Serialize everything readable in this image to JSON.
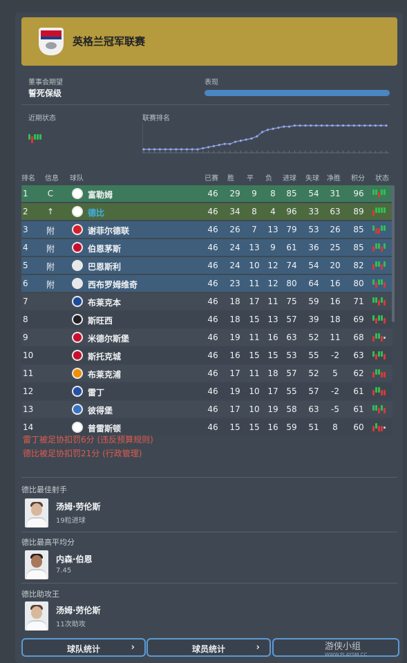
{
  "header": {
    "title": "英格兰冠军联赛",
    "logo_icon": "efl-logo-icon"
  },
  "board": {
    "label": "董事会期望",
    "value": "誓死保级"
  },
  "performance": {
    "label": "表现",
    "fraction": 1.0,
    "color": "#4a86c2"
  },
  "recent_form": {
    "label": "近期状态"
  },
  "league_position": {
    "label": "联赛排名"
  },
  "table": {
    "headers": [
      "排名",
      "信息",
      "球队",
      "已赛",
      "胜",
      "平",
      "负",
      "进球",
      "失球",
      "净胜",
      "积分",
      "状态"
    ],
    "rows": [
      {
        "pos": "1",
        "info": "C",
        "team": "富勒姆",
        "p": "46",
        "w": "29",
        "d": "9",
        "l": "8",
        "gf": "85",
        "ga": "54",
        "gd": "31",
        "pts": "96",
        "badge": "fulham-badge-icon"
      },
      {
        "pos": "2",
        "info": "↑",
        "team": "德比",
        "p": "46",
        "w": "34",
        "d": "8",
        "l": "4",
        "gf": "96",
        "ga": "33",
        "gd": "63",
        "pts": "89",
        "badge": "derby-badge-icon"
      },
      {
        "pos": "3",
        "info": "附",
        "team": "谢菲尔德联",
        "p": "46",
        "w": "26",
        "d": "7",
        "l": "13",
        "gf": "79",
        "ga": "53",
        "gd": "26",
        "pts": "85",
        "badge": "sheffield-badge-icon"
      },
      {
        "pos": "4",
        "info": "附",
        "team": "伯恩茅斯",
        "p": "46",
        "w": "24",
        "d": "13",
        "l": "9",
        "gf": "61",
        "ga": "36",
        "gd": "25",
        "pts": "85",
        "badge": "bournemouth-badge-icon"
      },
      {
        "pos": "5",
        "info": "附",
        "team": "巴恩斯利",
        "p": "46",
        "w": "24",
        "d": "10",
        "l": "12",
        "gf": "74",
        "ga": "54",
        "gd": "20",
        "pts": "82",
        "badge": "barnsley-badge-icon"
      },
      {
        "pos": "6",
        "info": "附",
        "team": "西布罗姆维奇",
        "p": "46",
        "w": "23",
        "d": "11",
        "l": "12",
        "gf": "80",
        "ga": "64",
        "gd": "16",
        "pts": "80",
        "badge": "westbrom-badge-icon"
      },
      {
        "pos": "7",
        "info": "",
        "team": "布莱克本",
        "p": "46",
        "w": "18",
        "d": "17",
        "l": "11",
        "gf": "75",
        "ga": "59",
        "gd": "16",
        "pts": "71",
        "badge": "blackburn-badge-icon"
      },
      {
        "pos": "8",
        "info": "",
        "team": "斯旺西",
        "p": "46",
        "w": "18",
        "d": "15",
        "l": "13",
        "gf": "57",
        "ga": "39",
        "gd": "18",
        "pts": "69",
        "badge": "swansea-badge-icon"
      },
      {
        "pos": "9",
        "info": "",
        "team": "米德尔斯堡",
        "p": "46",
        "w": "19",
        "d": "11",
        "l": "16",
        "gf": "63",
        "ga": "52",
        "gd": "11",
        "pts": "68",
        "badge": "middlesbrough-badge-icon"
      },
      {
        "pos": "10",
        "info": "",
        "team": "斯托克城",
        "p": "46",
        "w": "16",
        "d": "15",
        "l": "15",
        "gf": "53",
        "ga": "55",
        "gd": "-2",
        "pts": "63",
        "badge": "stoke-badge-icon"
      },
      {
        "pos": "11",
        "info": "",
        "team": "布莱克浦",
        "p": "46",
        "w": "17",
        "d": "11",
        "l": "18",
        "gf": "57",
        "ga": "52",
        "gd": "5",
        "pts": "62",
        "badge": "blackpool-badge-icon"
      },
      {
        "pos": "12",
        "info": "",
        "team": "雷丁",
        "p": "46",
        "w": "19",
        "d": "10",
        "l": "17",
        "gf": "55",
        "ga": "57",
        "gd": "-2",
        "pts": "61",
        "badge": "reading-badge-icon"
      },
      {
        "pos": "13",
        "info": "",
        "team": "彼得堡",
        "p": "46",
        "w": "17",
        "d": "10",
        "l": "19",
        "gf": "58",
        "ga": "63",
        "gd": "-5",
        "pts": "61",
        "badge": "peterborough-badge-icon"
      },
      {
        "pos": "14",
        "info": "",
        "team": "普雷斯顿",
        "p": "46",
        "w": "15",
        "d": "15",
        "l": "16",
        "gf": "59",
        "ga": "51",
        "gd": "8",
        "pts": "60",
        "badge": "preston-badge-icon"
      }
    ]
  },
  "penalties": [
    "雷丁被足协扣罚6分 (违反预算规则)",
    "德比被足协扣罚21分 (行政管理)"
  ],
  "top_scorer": {
    "title": "德比最佳射手",
    "name": "汤姆·劳伦斯",
    "stat": "19粒进球"
  },
  "top_rating": {
    "title": "德比最高平均分",
    "name": "内森·伯恩",
    "stat": "7.45"
  },
  "top_assists": {
    "title": "德比助攻王",
    "name": "汤姆·劳伦斯",
    "stat": "11次助攻"
  },
  "buttons": {
    "team_stats": "球队统计",
    "player_stats": "球员统计",
    "third": ""
  },
  "watermark": {
    "text": "游侠小组",
    "sub": "WWW.PLAYSM.CC"
  },
  "colors": {
    "win": "#2fbf52",
    "loss": "#d9383a",
    "draw": "#c9ced3",
    "champion_row": "#3c7a5b",
    "promoted_row": "#4d6a3f",
    "playoff_row": "#3f5e7c",
    "derby_text": "#3fb0e6"
  }
}
